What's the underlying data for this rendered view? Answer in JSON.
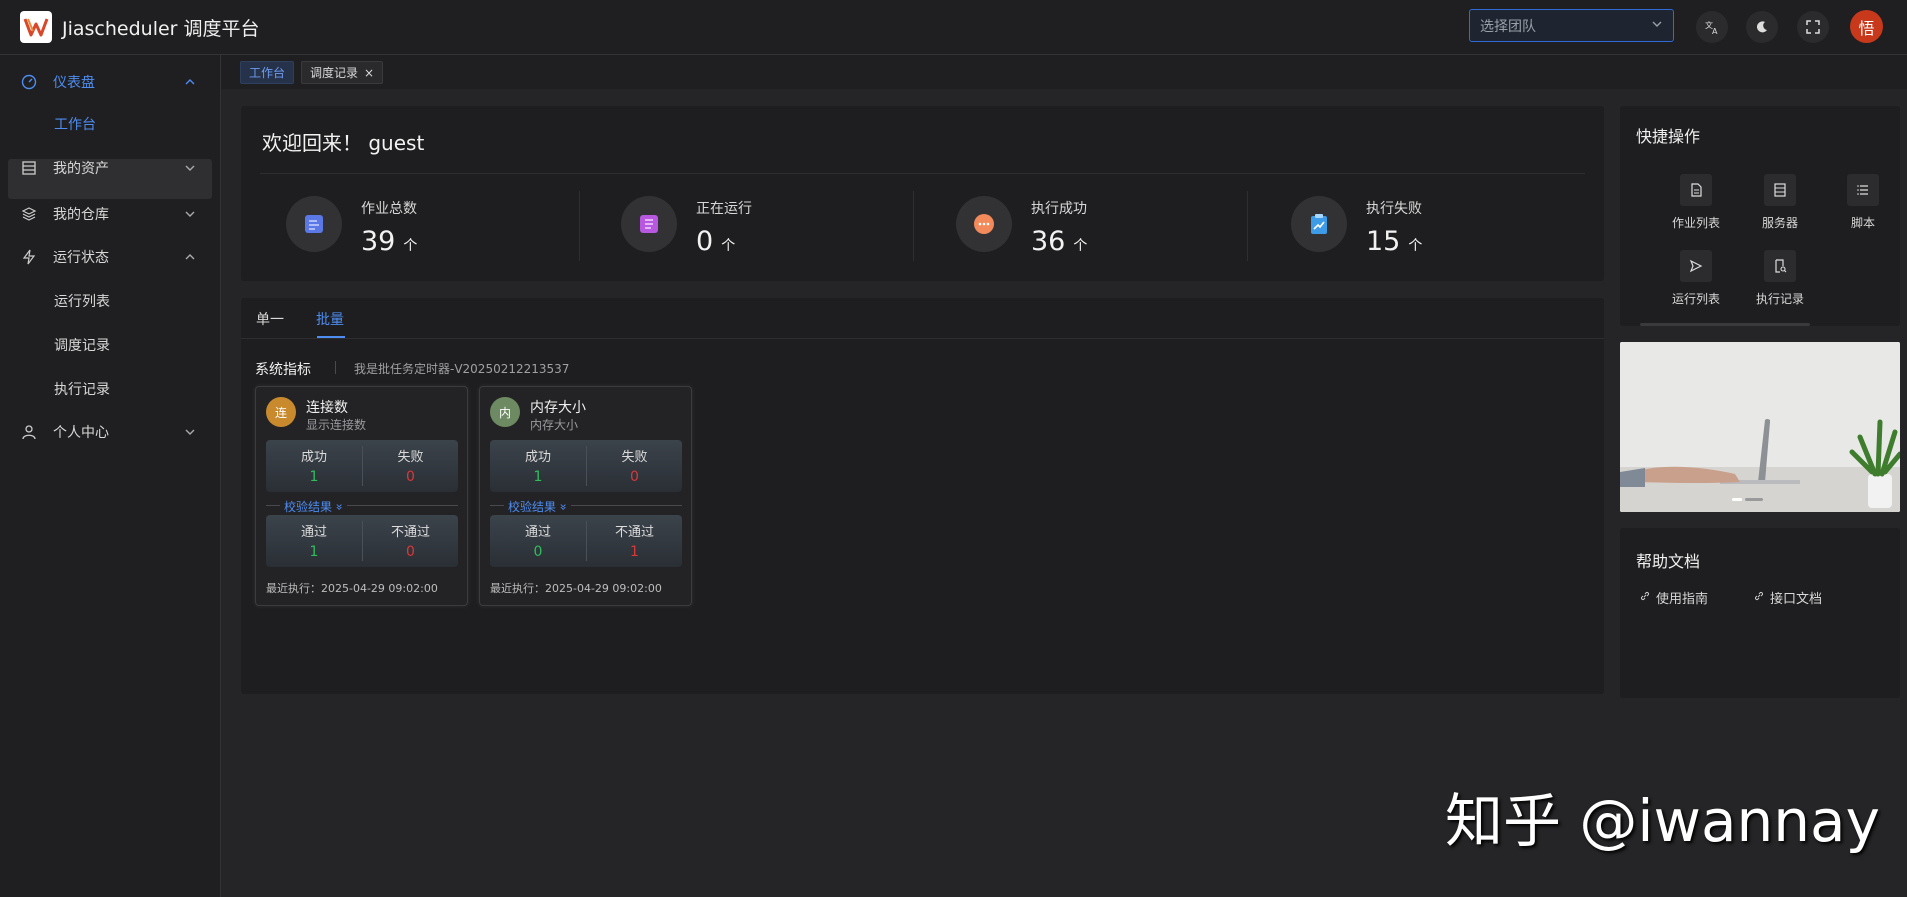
{
  "app": {
    "title": "Jiascheduler 调度平台"
  },
  "header": {
    "team_placeholder": "选择团队",
    "avatar_text": "悟"
  },
  "sidebar": {
    "dashboard": "仪表盘",
    "workbench": "工作台",
    "assets": "我的资产",
    "repo": "我的仓库",
    "run_status": "运行状态",
    "run_list": "运行列表",
    "schedule_records": "调度记录",
    "exec_records": "执行记录",
    "personal": "个人中心"
  },
  "tabs": {
    "t1": "工作台",
    "t2": "调度记录",
    "close": "×"
  },
  "welcome": {
    "greeting": "欢迎回来！ guest",
    "stats": [
      {
        "label": "作业总数",
        "value": "39",
        "unit": "个"
      },
      {
        "label": "正在运行",
        "value": "0",
        "unit": "个"
      },
      {
        "label": "执行成功",
        "value": "36",
        "unit": "个"
      },
      {
        "label": "执行失败",
        "value": "15",
        "unit": "个"
      }
    ]
  },
  "quick": {
    "title": "快捷操作",
    "items": [
      "作业列表",
      "服务器",
      "脚本",
      "运行列表",
      "执行记录"
    ]
  },
  "help": {
    "title": "帮助文档",
    "links": [
      "使用指南",
      "接口文档"
    ]
  },
  "metrics": {
    "tab_single": "单一",
    "tab_batch": "批量",
    "section_title": "系统指标",
    "timer_name": "我是批任务定时器-V20250212213537",
    "verify_label": "校验结果",
    "cards": [
      {
        "avatar": "连",
        "avatar_color": "#c98a2e",
        "name": "连接数",
        "sub": "显示连接数",
        "success_label": "成功",
        "success": "1",
        "fail_label": "失败",
        "fail": "0",
        "pass_label": "通过",
        "pass": "1",
        "nopass_label": "不通过",
        "nopass": "0",
        "recent": "最近执行：2025-04-29 09:02:00"
      },
      {
        "avatar": "内",
        "avatar_color": "#6d8a62",
        "name": "内存大小",
        "sub": "内存大小",
        "success_label": "成功",
        "success": "1",
        "fail_label": "失败",
        "fail": "0",
        "pass_label": "通过",
        "pass": "0",
        "nopass_label": "不通过",
        "nopass": "1",
        "recent": "最近执行：2025-04-29 09:02:00"
      }
    ]
  },
  "watermark": "知乎 @iwannay"
}
